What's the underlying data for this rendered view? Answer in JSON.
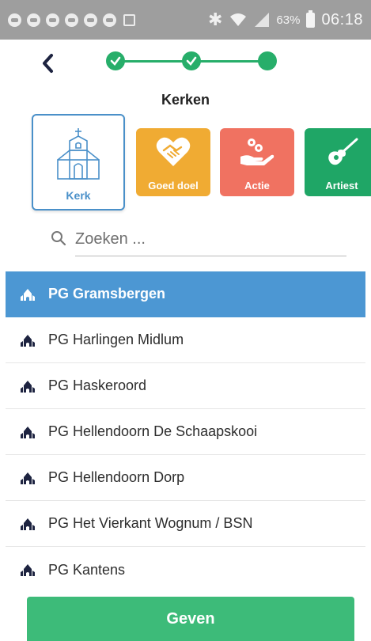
{
  "status_bar": {
    "battery_percent": "63%",
    "time": "06:18"
  },
  "header": {
    "title": "Kerken",
    "steps_total": 3,
    "steps_completed": 2
  },
  "categories": [
    {
      "label": "Kerk",
      "color": "#ffffff",
      "icon": "church-icon",
      "selected": true
    },
    {
      "label": "Goed doel",
      "color": "#f0ab33",
      "icon": "heart-handshake-icon",
      "selected": false
    },
    {
      "label": "Actie",
      "color": "#f07261",
      "icon": "coins-hand-icon",
      "selected": false
    },
    {
      "label": "Artiest",
      "color": "#1fa666",
      "icon": "guitar-icon",
      "selected": false
    }
  ],
  "search": {
    "placeholder": "Zoeken ...",
    "value": ""
  },
  "list": {
    "items": [
      {
        "label": "PG Gramsbergen",
        "selected": true
      },
      {
        "label": "PG Harlingen Midlum",
        "selected": false
      },
      {
        "label": "PG Haskeroord",
        "selected": false
      },
      {
        "label": "PG Hellendoorn De Schaapskooi",
        "selected": false
      },
      {
        "label": "PG Hellendoorn Dorp",
        "selected": false
      },
      {
        "label": "PG Het Vierkant Wognum / BSN",
        "selected": false
      },
      {
        "label": "PG Kantens",
        "selected": false
      }
    ]
  },
  "actions": {
    "give_label": "Geven"
  },
  "colors": {
    "accent_blue": "#4c97d3",
    "accent_green": "#27ae6a",
    "status_bar": "#9e9e9e"
  }
}
